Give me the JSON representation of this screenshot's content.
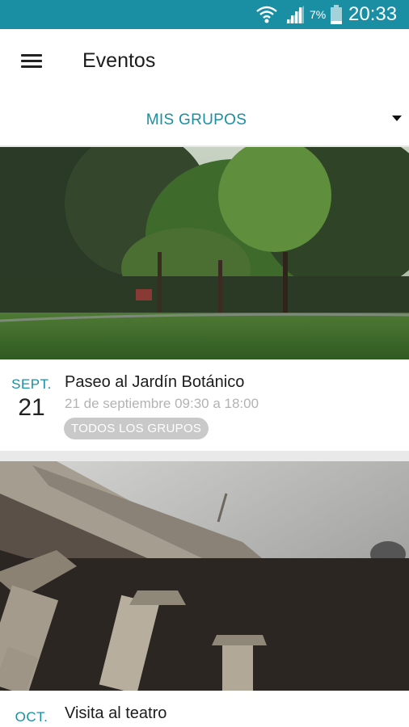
{
  "status_bar": {
    "battery_percent": "7%",
    "time": "20:33",
    "icons": [
      "wifi-icon",
      "signal-icon",
      "battery-icon"
    ],
    "color": "#1a8ea3"
  },
  "app_bar": {
    "title": "Eventos",
    "menu_icon": "hamburger-menu-icon"
  },
  "group_selector": {
    "selected": "MIS GRUPOS",
    "icon": "dropdown-arrow-icon",
    "accent_color": "#1a8ea3"
  },
  "events": [
    {
      "month": "SEPT.",
      "day": "21",
      "title": "Paseo al Jardín Botánico",
      "time": "21 de septiembre 09:30 a 18:00",
      "group_chip": "TODOS LOS GRUPOS",
      "image": "park-trees-photo"
    },
    {
      "month": "OCT.",
      "title": "Visita al teatro",
      "image": "neoclassical-theater-facade-photo"
    }
  ]
}
